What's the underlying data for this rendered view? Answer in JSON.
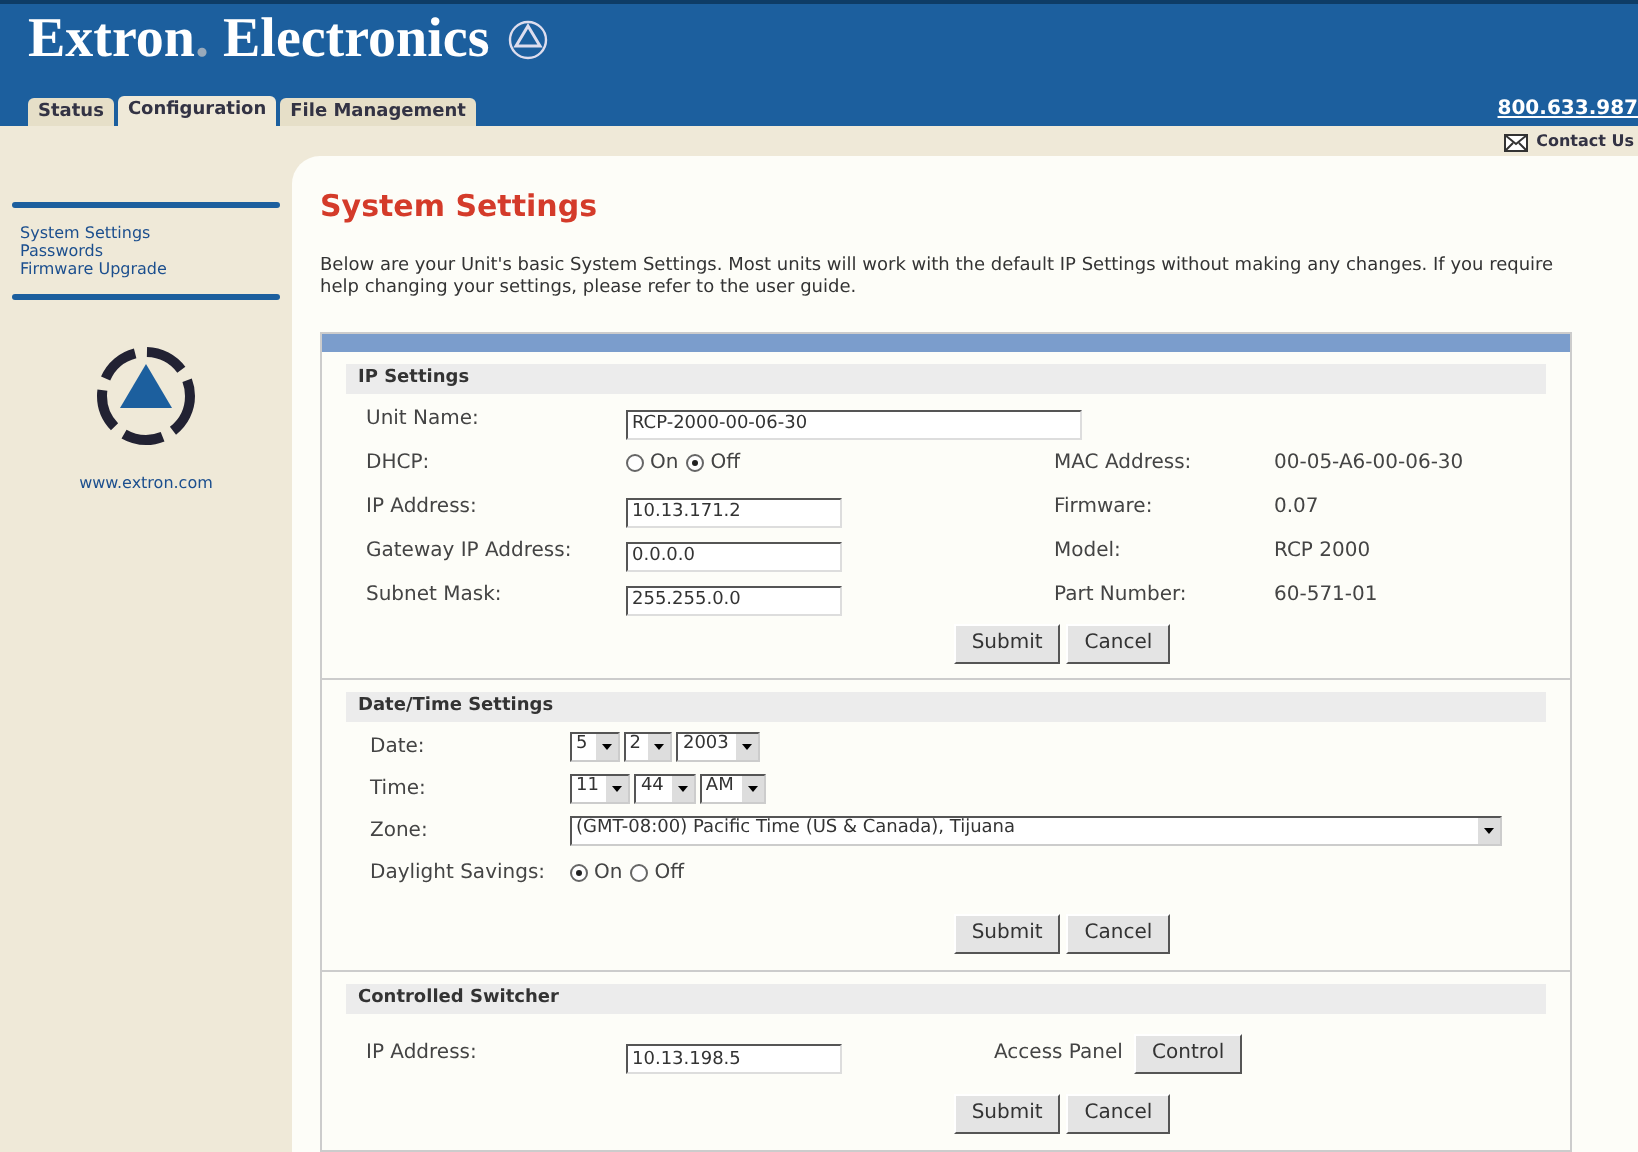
{
  "header": {
    "brand": "Extron",
    "brand_dot": ".",
    "brand_rest": "Electronics",
    "phone": "800.633.987",
    "contact": "Contact Us"
  },
  "tabs": [
    {
      "label": "Status",
      "selected": false
    },
    {
      "label": "Configuration",
      "selected": true
    },
    {
      "label": "File Management",
      "selected": false
    }
  ],
  "sidebar": {
    "links": [
      "System Settings",
      "Passwords",
      "Firmware Upgrade"
    ],
    "website": "www.extron.com"
  },
  "page": {
    "title": "System Settings",
    "intro": "Below are your Unit's basic System Settings. Most units will work with the default IP Settings without making any changes. If you require help changing your settings, please refer to the user guide."
  },
  "ip_settings": {
    "title": "IP Settings",
    "rows": [
      {
        "label": "Unit Name:",
        "kind": "input",
        "value": "RCP-2000-00-06-30",
        "wide": true
      },
      {
        "label": "DHCP:",
        "kind": "radio",
        "options": [
          {
            "label": "On",
            "selected": false
          },
          {
            "label": "Off",
            "selected": true
          }
        ],
        "info_label": "MAC Address:",
        "info_value": "00-05-A6-00-06-30"
      },
      {
        "label": "IP Address:",
        "kind": "input",
        "value": "10.13.171.2",
        "wide": false,
        "info_label": "Firmware:",
        "info_value": "0.07"
      },
      {
        "label": "Gateway IP Address:",
        "kind": "input",
        "value": "0.0.0.0",
        "wide": false,
        "info_label": "Model:",
        "info_value": "RCP 2000"
      },
      {
        "label": "Subnet Mask:",
        "kind": "input",
        "value": "255.255.0.0",
        "wide": false,
        "info_label": "Part Number:",
        "info_value": "60-571-01"
      }
    ],
    "buttons": [
      "Submit",
      "Cancel"
    ]
  },
  "datetime": {
    "title": "Date/Time Settings",
    "rows": [
      {
        "label": "Date:",
        "kind": "select",
        "items": [
          "5",
          "2",
          "2003"
        ],
        "wide": false
      },
      {
        "label": "Time:",
        "kind": "select",
        "items": [
          "11",
          "44",
          "AM"
        ],
        "wide": false
      },
      {
        "label": "Zone:",
        "kind": "select",
        "items": [
          "(GMT-08:00) Pacific Time (US & Canada), Tijuana"
        ],
        "wide": true
      },
      {
        "label": "Daylight Savings:",
        "kind": "radio",
        "options": [
          {
            "label": "On",
            "selected": true
          },
          {
            "label": "Off",
            "selected": false
          }
        ]
      }
    ],
    "buttons": [
      "Submit",
      "Cancel"
    ]
  },
  "switcher": {
    "title": "Controlled Switcher",
    "ip_label": "IP Address:",
    "ip_value": "10.13.198.5",
    "panel_label": "Access Panel",
    "panel_button": "Control",
    "buttons": [
      "Submit",
      "Cancel"
    ]
  }
}
